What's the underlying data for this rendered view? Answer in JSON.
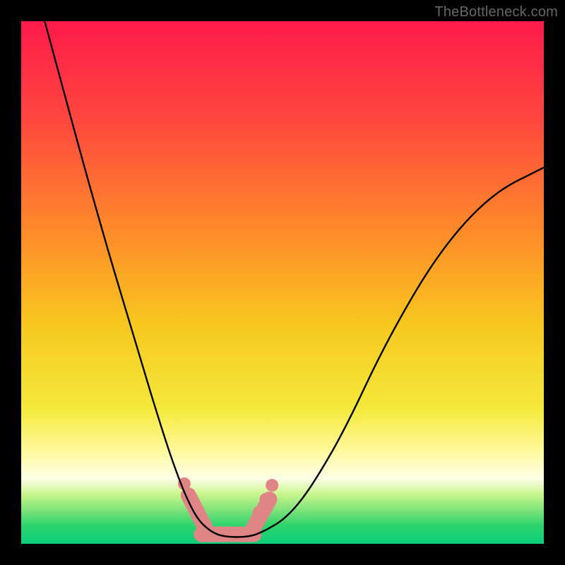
{
  "watermark": {
    "text": "TheBottleneck.com"
  },
  "chart_data": {
    "type": "line",
    "title": "",
    "xlabel": "",
    "ylabel": "",
    "xlim": [
      0,
      1
    ],
    "ylim": [
      0,
      1
    ],
    "background": {
      "type": "vertical-gradient",
      "stops": [
        {
          "offset": 0.0,
          "color": "#ff1a4b"
        },
        {
          "offset": 0.2,
          "color": "#ff4a3d"
        },
        {
          "offset": 0.4,
          "color": "#ff8a2a"
        },
        {
          "offset": 0.58,
          "color": "#f7c71f"
        },
        {
          "offset": 0.74,
          "color": "#f4e93a"
        },
        {
          "offset": 0.82,
          "color": "#fff99a"
        },
        {
          "offset": 0.875,
          "color": "#fdffe8"
        },
        {
          "offset": 0.905,
          "color": "#c9f58d"
        },
        {
          "offset": 0.935,
          "color": "#7fe37a"
        },
        {
          "offset": 0.965,
          "color": "#2fd46c"
        },
        {
          "offset": 1.0,
          "color": "#09ce7a"
        }
      ]
    },
    "series": [
      {
        "name": "bottleneck-curve",
        "x": [
          0.045,
          0.14,
          0.22,
          0.275,
          0.305,
          0.325,
          0.34,
          0.355,
          0.37,
          0.385,
          0.405,
          0.42,
          0.44,
          0.455,
          0.475,
          0.5,
          0.53,
          0.565,
          0.62,
          0.7,
          0.8,
          0.9,
          1.0
        ],
        "y": [
          1.0,
          0.65,
          0.38,
          0.2,
          0.115,
          0.07,
          0.045,
          0.03,
          0.02,
          0.015,
          0.013,
          0.013,
          0.015,
          0.02,
          0.03,
          0.045,
          0.075,
          0.125,
          0.22,
          0.39,
          0.56,
          0.67,
          0.72
        ],
        "stroke": "#000000",
        "stroke_width": 2.4
      }
    ],
    "overlay_segments": [
      {
        "name": "bottom-pill",
        "x": [
          0.345,
          0.445
        ],
        "y": [
          0.018,
          0.018
        ],
        "stroke": "#e08585",
        "stroke_width": 22
      },
      {
        "name": "left-rise",
        "x": [
          0.32,
          0.355
        ],
        "y": [
          0.093,
          0.025
        ],
        "stroke": "#e08585",
        "stroke_width": 22
      },
      {
        "name": "right-rise",
        "x": [
          0.44,
          0.475
        ],
        "y": [
          0.022,
          0.085
        ],
        "stroke": "#e08585",
        "stroke_width": 22
      }
    ],
    "dots": [
      {
        "x": 0.312,
        "y": 0.115,
        "r": 9,
        "color": "#e08585"
      },
      {
        "x": 0.322,
        "y": 0.09,
        "r": 9,
        "color": "#e08585"
      },
      {
        "x": 0.455,
        "y": 0.06,
        "r": 9,
        "color": "#e08585"
      },
      {
        "x": 0.468,
        "y": 0.085,
        "r": 9,
        "color": "#e08585"
      },
      {
        "x": 0.48,
        "y": 0.112,
        "r": 9,
        "color": "#e08585"
      }
    ]
  }
}
